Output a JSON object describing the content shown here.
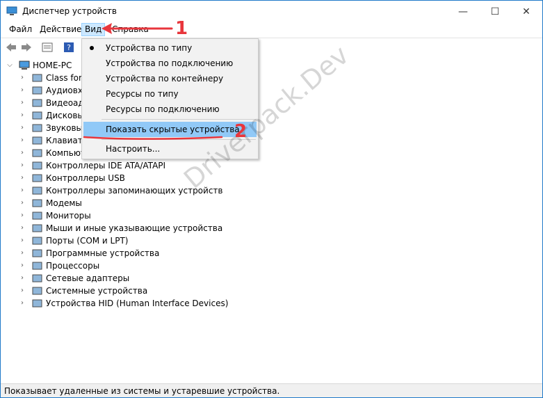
{
  "window": {
    "title": "Диспетчер устройств"
  },
  "titlebar_buttons": {
    "minimize": "—",
    "maximize": "☐",
    "close": "✕"
  },
  "menu": {
    "file": "Файл",
    "action": "Действие",
    "view": "Вид",
    "help": "Справка"
  },
  "view_menu": {
    "items": [
      {
        "label": "Устройства по типу",
        "checked": true
      },
      {
        "label": "Устройства по подключению"
      },
      {
        "label": "Устройства по контейнеру"
      },
      {
        "label": "Ресурсы по типу"
      },
      {
        "label": "Ресурсы по подключению"
      },
      {
        "label": "Показать скрытые устройства",
        "highlighted": true
      },
      {
        "label": "Настроить..."
      }
    ]
  },
  "tree": {
    "root": "HOME-PC",
    "items": [
      {
        "label": "Class for I",
        "icon": "class-icon"
      },
      {
        "label": "Аудиовхо",
        "icon": "audio-icon"
      },
      {
        "label": "Видеоада",
        "icon": "display-adapter-icon"
      },
      {
        "label": "Дисковы",
        "icon": "disk-icon"
      },
      {
        "label": "Звуковые",
        "icon": "sound-icon"
      },
      {
        "label": "Клавиату",
        "icon": "keyboard-icon"
      },
      {
        "label": "Компьют",
        "icon": "computer-icon"
      },
      {
        "label": "Контроллеры IDE ATA/ATAPI",
        "icon": "ide-icon"
      },
      {
        "label": "Контроллеры USB",
        "icon": "usb-icon"
      },
      {
        "label": "Контроллеры запоминающих устройств",
        "icon": "storage-icon"
      },
      {
        "label": "Модемы",
        "icon": "modem-icon"
      },
      {
        "label": "Мониторы",
        "icon": "monitor-icon"
      },
      {
        "label": "Мыши и иные указывающие устройства",
        "icon": "mouse-icon"
      },
      {
        "label": "Порты (COM и LPT)",
        "icon": "port-icon"
      },
      {
        "label": "Программные устройства",
        "icon": "software-device-icon"
      },
      {
        "label": "Процессоры",
        "icon": "cpu-icon"
      },
      {
        "label": "Сетевые адаптеры",
        "icon": "network-icon"
      },
      {
        "label": "Системные устройства",
        "icon": "system-icon"
      },
      {
        "label": "Устройства HID (Human Interface Devices)",
        "icon": "hid-icon"
      }
    ]
  },
  "status_bar": "Показывает удаленные из системы и устаревшие устройства.",
  "annotations": {
    "step1": "1",
    "step2": "2",
    "watermark": "Driverpack.Dev",
    "accent": "#e8363c"
  }
}
